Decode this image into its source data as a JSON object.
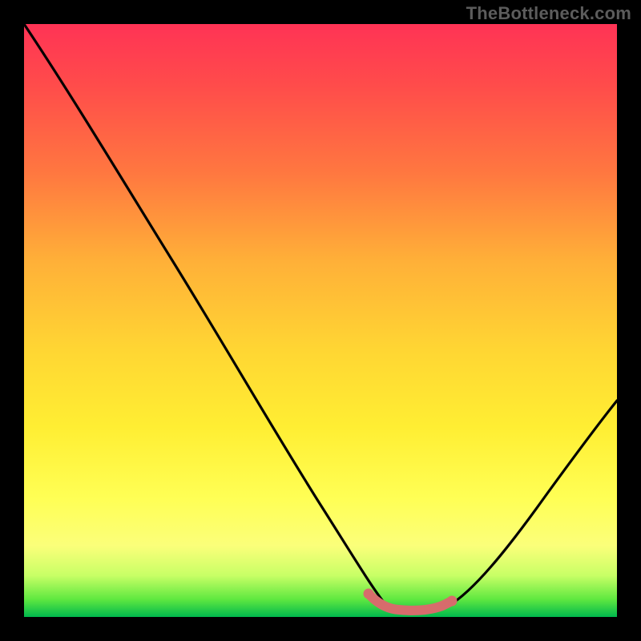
{
  "watermark": "TheBottleneck.com",
  "chart_data": {
    "type": "line",
    "title": "",
    "xlabel": "",
    "ylabel": "",
    "xlim": [
      0,
      100
    ],
    "ylim": [
      0,
      100
    ],
    "series": [
      {
        "name": "black-curve",
        "x": [
          0,
          10,
          20,
          30,
          40,
          50,
          58,
          62,
          68,
          72,
          80,
          90,
          100
        ],
        "y": [
          100,
          85,
          70,
          55,
          39,
          23,
          8,
          1,
          1,
          1,
          8,
          22,
          36
        ]
      },
      {
        "name": "pink-highlight",
        "x": [
          58,
          62,
          66,
          70,
          72
        ],
        "y": [
          3.5,
          1.2,
          1.0,
          1.2,
          1.8
        ]
      }
    ],
    "colors": {
      "black-curve": "#000000",
      "pink-highlight": "#d76c6c",
      "gradient_top": "#ff3355",
      "gradient_mid": "#ffee33",
      "gradient_bottom": "#00b84d"
    }
  }
}
